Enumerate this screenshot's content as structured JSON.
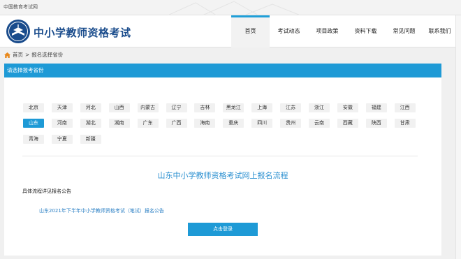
{
  "topbar": {
    "text": "中国教育考试网"
  },
  "header": {
    "site_title": "中小学教师资格考试"
  },
  "nav": {
    "items": [
      {
        "label": "首页",
        "active": true
      },
      {
        "label": "考试动态"
      },
      {
        "label": "项目政策"
      },
      {
        "label": "资料下载"
      },
      {
        "label": "常见问题"
      },
      {
        "label": "联系我们"
      }
    ]
  },
  "breadcrumb": {
    "home": "首页",
    "sep": ">",
    "current": "报名选择省份"
  },
  "panel": {
    "header": "请选择报考省份"
  },
  "provinces": {
    "row1": [
      "北京",
      "天津",
      "河北",
      "山西",
      "内蒙古",
      "辽宁",
      "吉林",
      "黑龙江",
      "上海",
      "江苏",
      "浙江",
      "安徽",
      "福建",
      "江西"
    ],
    "row2": [
      "山东",
      "河南",
      "湖北",
      "湖南",
      "广东",
      "广西",
      "海南",
      "重庆",
      "四川",
      "贵州",
      "云南",
      "西藏",
      "陕西",
      "甘肃"
    ],
    "row3": [
      "青海",
      "宁夏",
      "新疆"
    ],
    "selected": "山东"
  },
  "content": {
    "flow_title": "山东中小学教师资格考试网上报名流程",
    "detail_label": "具体流程详见报名公告",
    "notice_link": "山东2021年下半年中小学教师资格考试（笔试）报名公告",
    "login_button": "点击登录"
  },
  "colors": {
    "accent": "#1e9ad6",
    "title_blue": "#1a4c8c",
    "link": "#2a7fc4"
  }
}
